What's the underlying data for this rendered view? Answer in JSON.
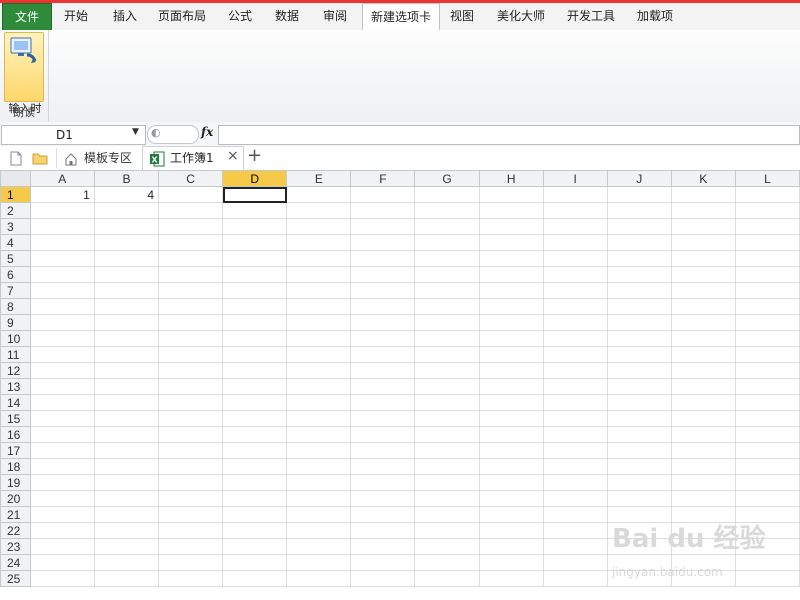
{
  "ribbon_tabs": [
    {
      "label": "文件",
      "kind": "file"
    },
    {
      "label": "开始",
      "kind": "tab"
    },
    {
      "label": "插入",
      "kind": "tab"
    },
    {
      "label": "页面布局",
      "kind": "tab"
    },
    {
      "label": "公式",
      "kind": "tab"
    },
    {
      "label": "数据",
      "kind": "tab"
    },
    {
      "label": "审阅",
      "kind": "tab"
    },
    {
      "label": "新建选项卡",
      "kind": "active"
    },
    {
      "label": "视图",
      "kind": "tab"
    },
    {
      "label": "美化大师",
      "kind": "tab"
    },
    {
      "label": "开发工具",
      "kind": "tab"
    },
    {
      "label": "加载项",
      "kind": "tab"
    }
  ],
  "ribbon": {
    "button_label": "输入时",
    "button_icon": "speech-monitor-icon",
    "group_label": "朗读"
  },
  "formula_bar": {
    "name_box": "D1",
    "fx_label": "fx",
    "formula": ""
  },
  "doc_tabs": {
    "template_label": "模板专区",
    "workbook_label": "工作簿1",
    "close": "×",
    "add": "+"
  },
  "sheet": {
    "columns": [
      "A",
      "B",
      "C",
      "D",
      "E",
      "F",
      "G",
      "H",
      "I",
      "J",
      "K",
      "L"
    ],
    "selected_column": "D",
    "selected_row": 1,
    "row_count": 25,
    "cells": {
      "A1": "1",
      "B1": "4"
    }
  },
  "colors": {
    "file_tab": "#2e8b3a",
    "selected_header": "#f7c948",
    "top_accent": "#e33"
  },
  "watermark": {
    "main": "Bai du 经验",
    "sub": "jingyan.baidu.com"
  }
}
